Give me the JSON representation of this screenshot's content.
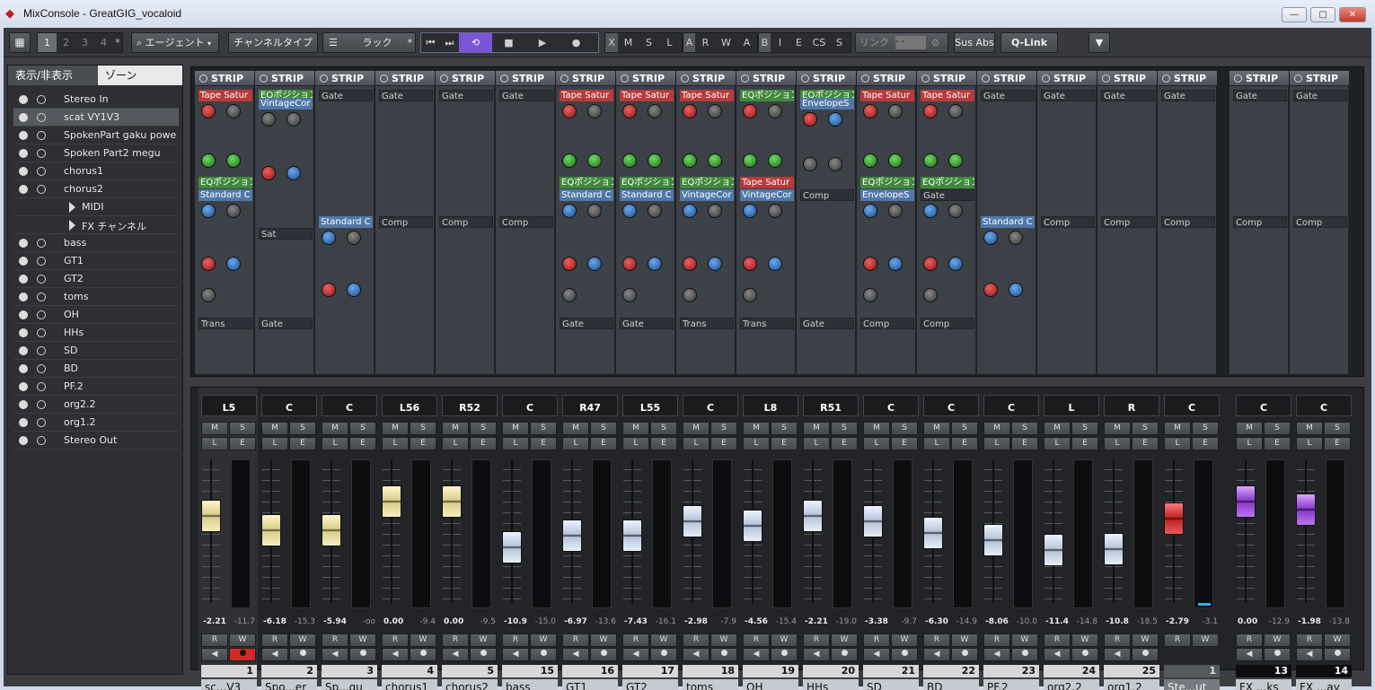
{
  "window": {
    "title": "MixConsole - GreatGIG_vocaloid",
    "minimize": "—",
    "maximize": "▢",
    "close": "✕"
  },
  "toolbar": {
    "pages": [
      "1",
      "2",
      "3",
      "4"
    ],
    "star": "*",
    "agent": "エージェント",
    "channel_type": "チャンネルタイプ",
    "rack": "ラック",
    "rack_star": "*",
    "transport": [
      "⏮",
      "⏭",
      "⟲",
      "■",
      "▶",
      "●"
    ],
    "xmsl": [
      "X",
      "M",
      "S",
      "L"
    ],
    "arwa": [
      "A",
      "R",
      "W",
      "A"
    ],
    "biecs": [
      "B",
      "I",
      "E",
      "CS",
      "S"
    ],
    "link": "リンク",
    "link_value": "- -",
    "sus_abs": "Sus Abs",
    "qlink": "Q-Link",
    "menu": "▼"
  },
  "left_panel": {
    "tab_show": "表示/非表示",
    "tab_zone": "ゾーン",
    "tracks": [
      {
        "name": "Stereo In",
        "type": "track"
      },
      {
        "name": "scat VY1V3",
        "type": "track",
        "selected": true
      },
      {
        "name": "SpokenPart gaku powe",
        "type": "track"
      },
      {
        "name": "Spoken Part2 megu",
        "type": "track"
      },
      {
        "name": "chorus1",
        "type": "track"
      },
      {
        "name": "chorus2",
        "type": "track"
      },
      {
        "name": "MIDI",
        "type": "folder"
      },
      {
        "name": "FX チャンネル",
        "type": "folder"
      },
      {
        "name": "bass",
        "type": "track"
      },
      {
        "name": "GT1",
        "type": "track"
      },
      {
        "name": "GT2",
        "type": "track"
      },
      {
        "name": "toms",
        "type": "track"
      },
      {
        "name": "OH",
        "type": "track"
      },
      {
        "name": "HHs",
        "type": "track"
      },
      {
        "name": "SD",
        "type": "track"
      },
      {
        "name": "BD",
        "type": "track"
      },
      {
        "name": "PF.2",
        "type": "track"
      },
      {
        "name": "org2.2",
        "type": "track"
      },
      {
        "name": "org1.2",
        "type": "track"
      },
      {
        "name": "Stereo Out",
        "type": "track"
      }
    ]
  },
  "rack": {
    "strip_label": "STRIP",
    "strips": [
      {
        "modules": [
          {
            "t": "Tape Satur",
            "c": "red"
          },
          {
            "t": "EQポジション",
            "c": "green"
          },
          {
            "t": "Standard C",
            "c": "blue"
          },
          {
            "t": "Trans",
            "c": "empty"
          }
        ],
        "kind": "full"
      },
      {
        "modules": [
          {
            "t": "EQポジション",
            "c": "green"
          },
          {
            "t": "VintageCor",
            "c": "blue"
          },
          {
            "t": "Sat",
            "c": "empty"
          },
          {
            "t": "Gate",
            "c": "empty"
          }
        ],
        "kind": "vint"
      },
      {
        "modules": [
          {
            "t": "Gate",
            "c": "empty"
          },
          {
            "t": "Standard C",
            "c": "blue"
          }
        ],
        "kind": "gate"
      },
      {
        "modules": [
          {
            "t": "Gate",
            "c": "empty"
          },
          {
            "t": "Comp",
            "c": "empty"
          }
        ],
        "kind": "plain"
      },
      {
        "modules": [
          {
            "t": "Gate",
            "c": "empty"
          },
          {
            "t": "Comp",
            "c": "empty"
          }
        ],
        "kind": "plain"
      },
      {
        "modules": [
          {
            "t": "Gate",
            "c": "empty"
          },
          {
            "t": "Comp",
            "c": "empty"
          }
        ],
        "kind": "plain"
      },
      {
        "modules": [
          {
            "t": "Tape Satur",
            "c": "red"
          },
          {
            "t": "EQポジション",
            "c": "green"
          },
          {
            "t": "Standard C",
            "c": "blue"
          },
          {
            "t": "Gate",
            "c": "empty"
          }
        ],
        "kind": "full"
      },
      {
        "modules": [
          {
            "t": "Tape Satur",
            "c": "red"
          },
          {
            "t": "EQポジション",
            "c": "green"
          },
          {
            "t": "Standard C",
            "c": "blue"
          },
          {
            "t": "Gate",
            "c": "empty"
          }
        ],
        "kind": "full"
      },
      {
        "modules": [
          {
            "t": "Tape Satur",
            "c": "red"
          },
          {
            "t": "EQポジション",
            "c": "green"
          },
          {
            "t": "VintageCor",
            "c": "blue"
          },
          {
            "t": "Trans",
            "c": "empty"
          }
        ],
        "kind": "full"
      },
      {
        "modules": [
          {
            "t": "EQポジション",
            "c": "green"
          },
          {
            "t": "Tape Satur",
            "c": "red"
          },
          {
            "t": "VintageCor",
            "c": "blue"
          },
          {
            "t": "Trans",
            "c": "empty"
          }
        ],
        "kind": "full"
      },
      {
        "modules": [
          {
            "t": "EQポジション",
            "c": "green"
          },
          {
            "t": "EnvelopeS",
            "c": "blue"
          },
          {
            "t": "Comp",
            "c": "empty"
          },
          {
            "t": "Gate",
            "c": "empty"
          }
        ],
        "kind": "env"
      },
      {
        "modules": [
          {
            "t": "Tape Satur",
            "c": "red"
          },
          {
            "t": "EQポジション",
            "c": "green"
          },
          {
            "t": "EnvelopeS",
            "c": "blue"
          },
          {
            "t": "Comp",
            "c": "empty"
          }
        ],
        "kind": "full"
      },
      {
        "modules": [
          {
            "t": "Tape Satur",
            "c": "red"
          },
          {
            "t": "EQポジション",
            "c": "green"
          },
          {
            "t": "Gate",
            "c": "empty"
          },
          {
            "t": "Comp",
            "c": "empty"
          }
        ],
        "kind": "full"
      },
      {
        "modules": [
          {
            "t": "Gate",
            "c": "empty"
          },
          {
            "t": "Standard C",
            "c": "blue"
          }
        ],
        "kind": "gate"
      },
      {
        "modules": [
          {
            "t": "Gate",
            "c": "empty"
          },
          {
            "t": "Comp",
            "c": "empty"
          }
        ],
        "kind": "plain"
      },
      {
        "modules": [
          {
            "t": "Gate",
            "c": "empty"
          },
          {
            "t": "Comp",
            "c": "empty"
          }
        ],
        "kind": "plain"
      },
      {
        "modules": [
          {
            "t": "Gate",
            "c": "empty"
          },
          {
            "t": "Comp",
            "c": "empty"
          }
        ],
        "kind": "plain"
      },
      {
        "modules": [
          {
            "t": "Gate",
            "c": "empty"
          },
          {
            "t": "Comp",
            "c": "empty"
          }
        ],
        "kind": "plain"
      },
      {
        "modules": [
          {
            "t": "Gate",
            "c": "empty"
          },
          {
            "t": "Comp",
            "c": "empty"
          }
        ],
        "kind": "plain"
      }
    ]
  },
  "mixer": {
    "btn": {
      "m": "M",
      "s": "S",
      "l": "L",
      "e": "E",
      "r": "R",
      "w": "W"
    },
    "channels": [
      {
        "pan": "L5",
        "vol": "-2.21",
        "peak": "-11.7",
        "num": "1",
        "name": "sc...V3",
        "color": "yellow",
        "level": 0.72,
        "rec": true
      },
      {
        "pan": "C",
        "vol": "-6.18",
        "peak": "-15.3",
        "num": "2",
        "name": "Spo...er",
        "color": "yellow",
        "level": 0.62
      },
      {
        "pan": "C",
        "vol": "-5.94",
        "peak": "-oo",
        "num": "3",
        "name": "Sp...gu",
        "color": "yellow",
        "level": 0.62
      },
      {
        "pan": "L56",
        "vol": "0.00",
        "peak": "-9.4",
        "num": "4",
        "name": "chorus1",
        "color": "yellow",
        "level": 0.82
      },
      {
        "pan": "R52",
        "vol": "0.00",
        "peak": "-9.5",
        "num": "5",
        "name": "chorus2",
        "color": "yellow",
        "level": 0.82
      },
      {
        "pan": "C",
        "vol": "-10.9",
        "peak": "-15.0",
        "num": "15",
        "name": "bass",
        "color": "blue",
        "level": 0.5
      },
      {
        "pan": "R47",
        "vol": "-6.97",
        "peak": "-13.6",
        "num": "16",
        "name": "GT1",
        "color": "blue",
        "level": 0.58
      },
      {
        "pan": "L55",
        "vol": "-7.43",
        "peak": "-16.1",
        "num": "17",
        "name": "GT2",
        "color": "blue",
        "level": 0.58
      },
      {
        "pan": "C",
        "vol": "-2.98",
        "peak": "-7.9",
        "num": "18",
        "name": "toms",
        "color": "blue",
        "level": 0.68
      },
      {
        "pan": "L8",
        "vol": "-4.56",
        "peak": "-15.4",
        "num": "19",
        "name": "OH",
        "color": "blue",
        "level": 0.65
      },
      {
        "pan": "R51",
        "vol": "-2.21",
        "peak": "-19.0",
        "num": "20",
        "name": "HHs",
        "color": "blue",
        "level": 0.72
      },
      {
        "pan": "C",
        "vol": "-3.38",
        "peak": "-9.7",
        "num": "21",
        "name": "SD",
        "color": "blue",
        "level": 0.68
      },
      {
        "pan": "C",
        "vol": "-6.30",
        "peak": "-14.9",
        "num": "22",
        "name": "BD",
        "color": "blue",
        "level": 0.6
      },
      {
        "pan": "C",
        "vol": "-8.06",
        "peak": "-10.0",
        "num": "23",
        "name": "PF.2",
        "color": "blue",
        "level": 0.55
      },
      {
        "pan": "L",
        "vol": "-11.4",
        "peak": "-14.8",
        "num": "24",
        "name": "org2.2",
        "color": "blue",
        "level": 0.48
      },
      {
        "pan": "R",
        "vol": "-10.8",
        "peak": "-18.5",
        "num": "25",
        "name": "org1.2",
        "color": "blue",
        "level": 0.49
      },
      {
        "pan": "C",
        "vol": "-2.79",
        "peak": "-3.1",
        "num": "1",
        "name": "Ste...ut",
        "color": "red",
        "level": 0.7,
        "output": true
      },
      {
        "pan": "C",
        "vol": "0.00",
        "peak": "-12.9",
        "num": "13",
        "name": "FX ...ks",
        "color": "purple",
        "level": 0.82,
        "fx": true
      },
      {
        "pan": "C",
        "vol": "-1.98",
        "peak": "-13.8",
        "num": "14",
        "name": "FX ...ay",
        "color": "purple",
        "level": 0.76,
        "fx": true
      }
    ]
  }
}
